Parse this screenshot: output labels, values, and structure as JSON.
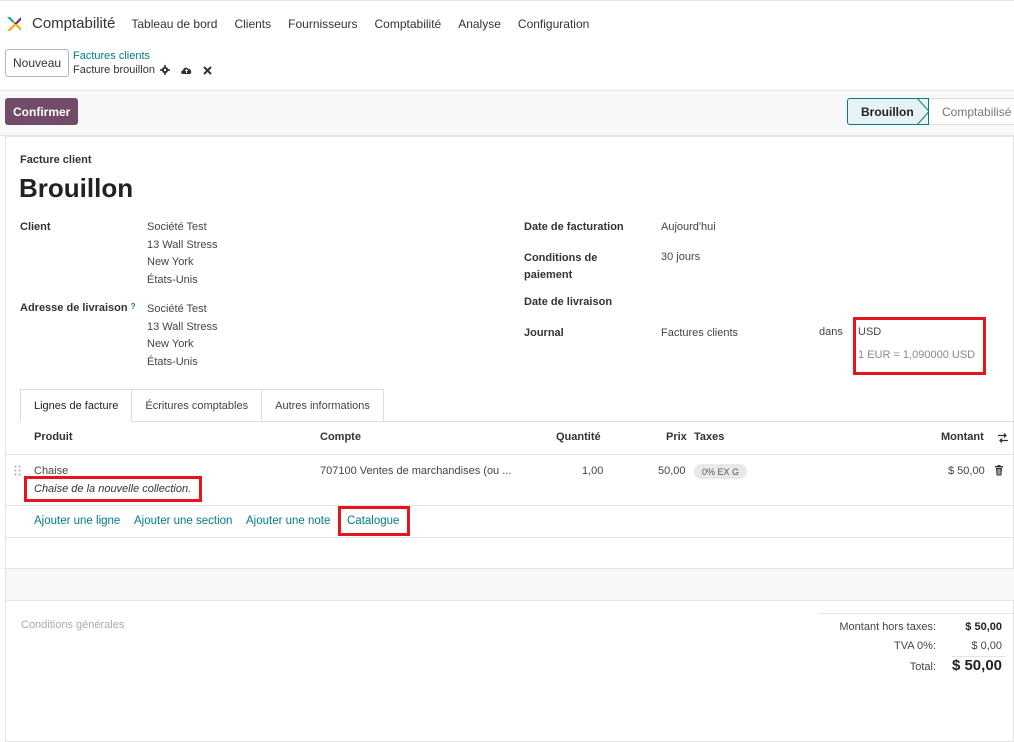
{
  "navbar": {
    "app_name": "Comptabilité",
    "menu": [
      "Tableau de bord",
      "Clients",
      "Fournisseurs",
      "Comptabilité",
      "Analyse",
      "Configuration"
    ]
  },
  "control": {
    "new_label": "Nouveau",
    "breadcrumb_parent": "Factures clients",
    "breadcrumb_current": "Facture brouillon"
  },
  "status": {
    "confirm_label": "Confirmer",
    "stages": [
      "Brouillon",
      "Comptabilisé"
    ],
    "active_stage": "Brouillon"
  },
  "form": {
    "type_label": "Facture client",
    "title": "Brouillon",
    "client_label": "Client",
    "client_lines": [
      "Société Test",
      "13 Wall Stress",
      "New York",
      "États-Unis"
    ],
    "delivery_label": "Adresse de livraison",
    "delivery_help": "?",
    "delivery_lines": [
      "Société Test",
      "13 Wall Stress",
      "New York",
      "États-Unis"
    ],
    "invoice_date_label": "Date de facturation",
    "invoice_date_value": "Aujourd'hui",
    "payment_terms_label_1": "Conditions de",
    "payment_terms_label_2": "paiement",
    "payment_terms_value": "30 jours",
    "delivery_date_label": "Date de livraison",
    "journal_label": "Journal",
    "journal_value": "Factures clients",
    "in_label": "dans",
    "currency": "USD",
    "rate": "1 EUR = 1,090000 USD"
  },
  "tabs": [
    "Lignes de facture",
    "Écritures comptables",
    "Autres informations"
  ],
  "table": {
    "headers": {
      "product": "Produit",
      "account": "Compte",
      "quantity": "Quantité",
      "price": "Prix",
      "taxes": "Taxes",
      "amount": "Montant"
    },
    "row": {
      "product": "Chaise",
      "description": "Chaise de la nouvelle collection.",
      "account": "707100 Ventes de marchandises (ou ...",
      "quantity": "1,00",
      "price": "50,00",
      "tax": "0% EX G",
      "amount": "$ 50,00"
    }
  },
  "add_links": {
    "line": "Ajouter une ligne",
    "section": "Ajouter une section",
    "note": "Ajouter une note",
    "catalog": "Catalogue"
  },
  "footer": {
    "conditions_placeholder": "Conditions générales",
    "untaxed_label": "Montant hors taxes:",
    "untaxed_value": "$ 50,00",
    "tva_label": "TVA 0%:",
    "tva_value": "$ 0,00",
    "total_label": "Total:",
    "total_value": "$ 50,00"
  },
  "colors": {
    "brand": "#714b67",
    "link": "#017e84",
    "highlight": "#e4151f"
  }
}
